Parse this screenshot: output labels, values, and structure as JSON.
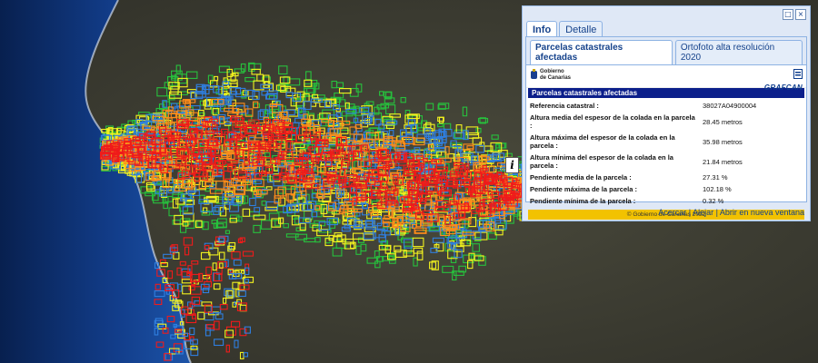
{
  "map": {
    "layers": [
      "ocean",
      "satellite-terrain",
      "cadastral-parcels"
    ],
    "parcel_colors": {
      "red": "#ef1b1b",
      "orange": "#ff8c1a",
      "blue": "#2f7fe0",
      "green": "#27c13d",
      "yellow": "#f2f21f"
    },
    "info_marker_glyph": "i"
  },
  "popup": {
    "tools": [
      "□",
      "×"
    ],
    "tabs": [
      {
        "label": "Info",
        "active": true
      },
      {
        "label": "Detalle",
        "active": false
      }
    ],
    "subtabs": [
      {
        "label": "Parcelas catastrales afectadas",
        "active": true
      },
      {
        "label": "Ortofoto alta resolución 2020",
        "active": false
      }
    ],
    "logo_left_line1": "Gobierno",
    "logo_left_line2": "de Canarias",
    "logo_right": "GRAFCAN",
    "section_title": "Parcelas catastrales afectadas",
    "rows": [
      {
        "key": "Referencia catastral :",
        "value": "38027A04900004"
      },
      {
        "key": "Altura media del espesor de la colada en la parcela :",
        "value": "28.45 metros"
      },
      {
        "key": "Altura máxima del espesor de la colada en la parcela :",
        "value": "35.98 metros"
      },
      {
        "key": "Altura mínima del espesor de la colada en la parcela :",
        "value": "21.84 metros"
      },
      {
        "key": "Pendiente media de la parcela :",
        "value": "27.31 %"
      },
      {
        "key": "Pendiente máxima de la parcela :",
        "value": "102.18 %"
      },
      {
        "key": "Pendiente mínima de la parcela :",
        "value": "0.32 %"
      }
    ],
    "copyright": "© Gobierno de Canarias 2022",
    "footer": {
      "zoom_in": "Acercar",
      "sep1": " | ",
      "zoom_out": "Alejar",
      "sep2": " | ",
      "open_new": "Abrir en nueva ventana"
    }
  }
}
